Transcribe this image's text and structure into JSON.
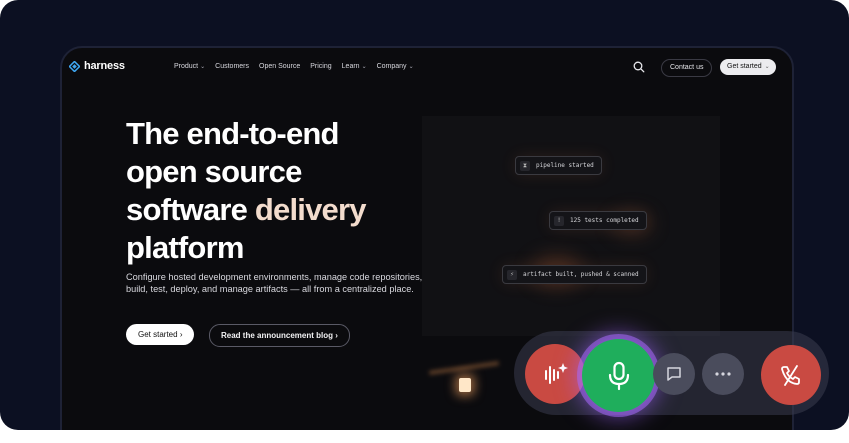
{
  "nav": {
    "logo_text": "harness",
    "links": [
      {
        "label": "Product",
        "dropdown": true
      },
      {
        "label": "Customers",
        "dropdown": false
      },
      {
        "label": "Open Source",
        "dropdown": false
      },
      {
        "label": "Pricing",
        "dropdown": false
      },
      {
        "label": "Learn",
        "dropdown": true
      },
      {
        "label": "Company",
        "dropdown": true
      }
    ],
    "contact_label": "Contact us",
    "get_started_label": "Get started"
  },
  "hero": {
    "title_line1": "The end-to-end",
    "title_line2": "open source",
    "title_line3a": "software ",
    "title_line3b": "delivery",
    "title_line4": "platform",
    "subtitle": "Configure hosted development environments, manage code repositories, build, test, deploy, and manage artifacts — all from a centralized place.",
    "cta_primary": "Get started",
    "cta_secondary": "Read the announcement blog"
  },
  "pipeline": {
    "steps": [
      "pipeline started",
      "125 tests completed",
      "artifact built, pushed & scanned"
    ]
  },
  "call_controls": {
    "buttons": [
      "ai-voice",
      "microphone",
      "chat",
      "more",
      "end-call"
    ],
    "colors": {
      "end": "#c94a42",
      "mic": "#1fae5c",
      "glow": "#a56cff",
      "neutral": "#4a4c5c"
    }
  }
}
